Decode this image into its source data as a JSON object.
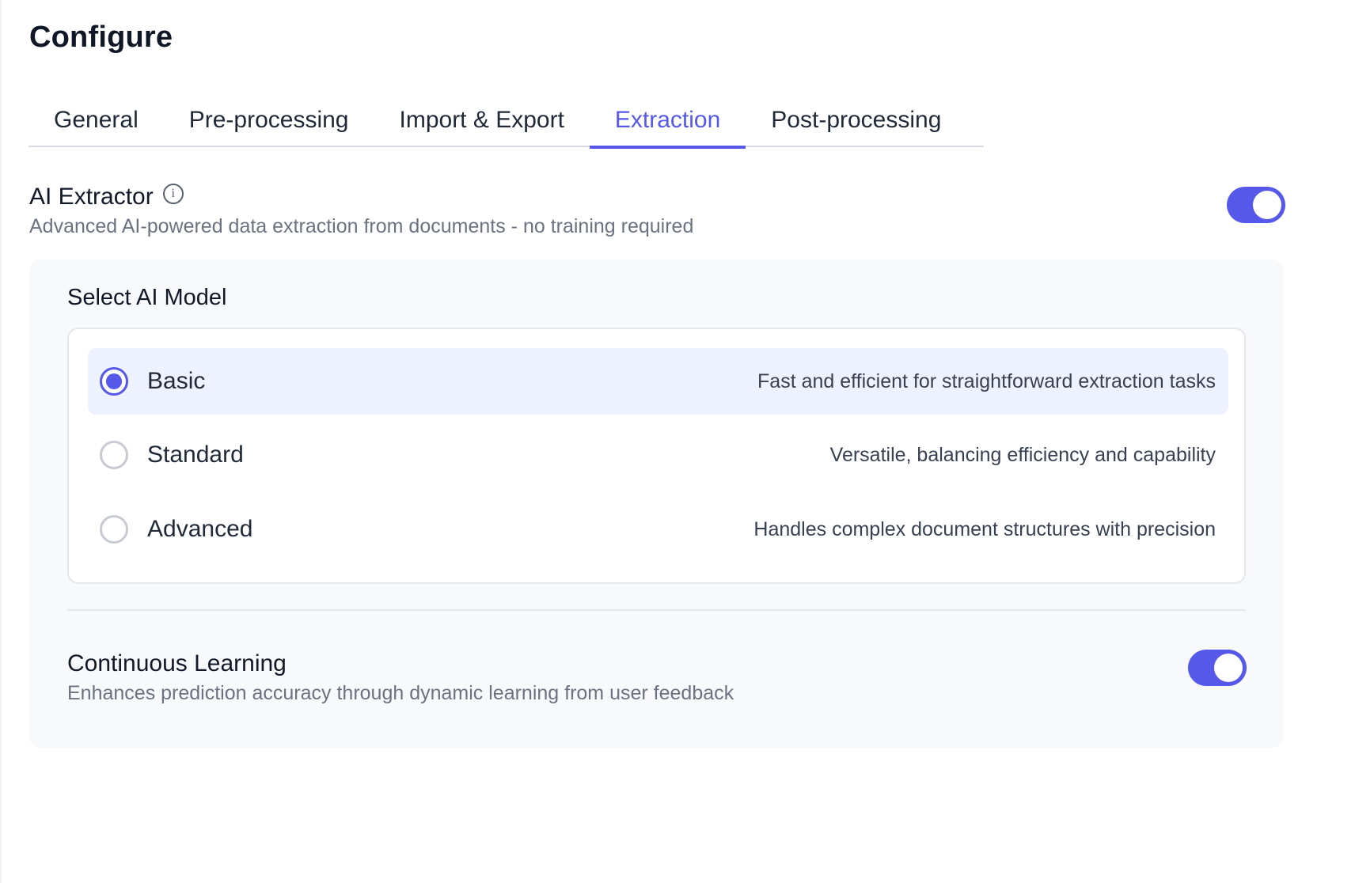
{
  "page": {
    "title": "Configure"
  },
  "tabs": [
    {
      "label": "General"
    },
    {
      "label": "Pre-processing"
    },
    {
      "label": "Import & Export"
    },
    {
      "label": "Extraction",
      "active": true
    },
    {
      "label": "Post-processing"
    }
  ],
  "ai_extractor": {
    "title": "AI Extractor",
    "info_icon": "info-icon",
    "description": "Advanced AI-powered data extraction from documents - no training required",
    "enabled": true
  },
  "model_select": {
    "label": "Select AI Model",
    "selected": "Basic",
    "options": [
      {
        "name": "Basic",
        "description": "Fast and efficient for straightforward extraction tasks",
        "checked": true
      },
      {
        "name": "Standard",
        "description": "Versatile, balancing efficiency and capability",
        "checked": false
      },
      {
        "name": "Advanced",
        "description": "Handles complex document structures with precision",
        "checked": false
      }
    ]
  },
  "continuous_learning": {
    "title": "Continuous Learning",
    "description": "Enhances prediction accuracy through dynamic learning from user feedback",
    "enabled": true
  },
  "colors": {
    "accent": "#5558e8",
    "selected_row_bg": "#eef2fe",
    "panel_bg": "#f8f9fb"
  }
}
